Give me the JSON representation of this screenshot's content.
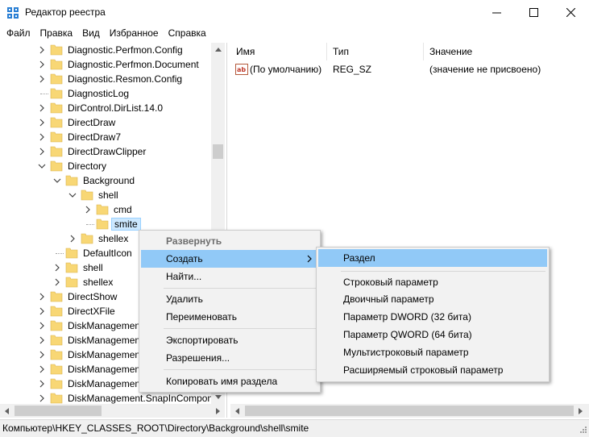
{
  "window": {
    "title": "Редактор реестра",
    "icon": "regedit-icon",
    "controls": [
      "minimize-icon",
      "maximize-icon",
      "close-icon"
    ]
  },
  "menu": [
    "Файл",
    "Правка",
    "Вид",
    "Избранное",
    "Справка"
  ],
  "tree": {
    "items": [
      {
        "label": "Diagnostic.Perfmon.Config"
      },
      {
        "label": "Diagnostic.Perfmon.Document"
      },
      {
        "label": "Diagnostic.Resmon.Config"
      },
      {
        "label": "DiagnosticLog"
      },
      {
        "label": "DirControl.DirList.14.0"
      },
      {
        "label": "DirectDraw"
      },
      {
        "label": "DirectDraw7"
      },
      {
        "label": "DirectDrawClipper"
      },
      {
        "label": "Directory"
      },
      {
        "label": "Background"
      },
      {
        "label": "shell"
      },
      {
        "label": "cmd"
      },
      {
        "label": "smite"
      },
      {
        "label": "shellex"
      },
      {
        "label": "DefaultIcon"
      },
      {
        "label": "shell"
      },
      {
        "label": "shellex"
      },
      {
        "label": "DirectShow"
      },
      {
        "label": "DirectXFile"
      },
      {
        "label": "DiskManagement.Connection"
      },
      {
        "label": "DiskManagement.Control"
      },
      {
        "label": "DiskManagement.DataObject"
      },
      {
        "label": "DiskManagement.SnapIn"
      },
      {
        "label": "DiskManagement.SnapInAbout"
      },
      {
        "label": "DiskManagement.SnapInCompon"
      }
    ]
  },
  "list": {
    "columns": [
      "Имя",
      "Тип",
      "Значение"
    ],
    "rows": [
      {
        "name": "(По умолчанию)",
        "type": "REG_SZ",
        "value": "(значение не присвоено)"
      }
    ]
  },
  "context_menu": {
    "items": [
      "Развернуть",
      "Создать",
      "Найти...",
      "Удалить",
      "Переименовать",
      "Экспортировать",
      "Разрешения...",
      "Копировать имя раздела"
    ]
  },
  "submenu": {
    "items": [
      "Раздел",
      "Строковый параметр",
      "Двоичный параметр",
      "Параметр DWORD (32 бита)",
      "Параметр QWORD (64 бита)",
      "Мультистроковый параметр",
      "Расширяемый строковый параметр"
    ]
  },
  "status": {
    "path": "Компьютер\\HKEY_CLASSES_ROOT\\Directory\\Background\\shell\\smite"
  },
  "colors": {
    "highlight": "#91c9f7",
    "selection": "#cce8ff",
    "folder": "#f8d775",
    "menu_bg": "#f2f2f2"
  }
}
